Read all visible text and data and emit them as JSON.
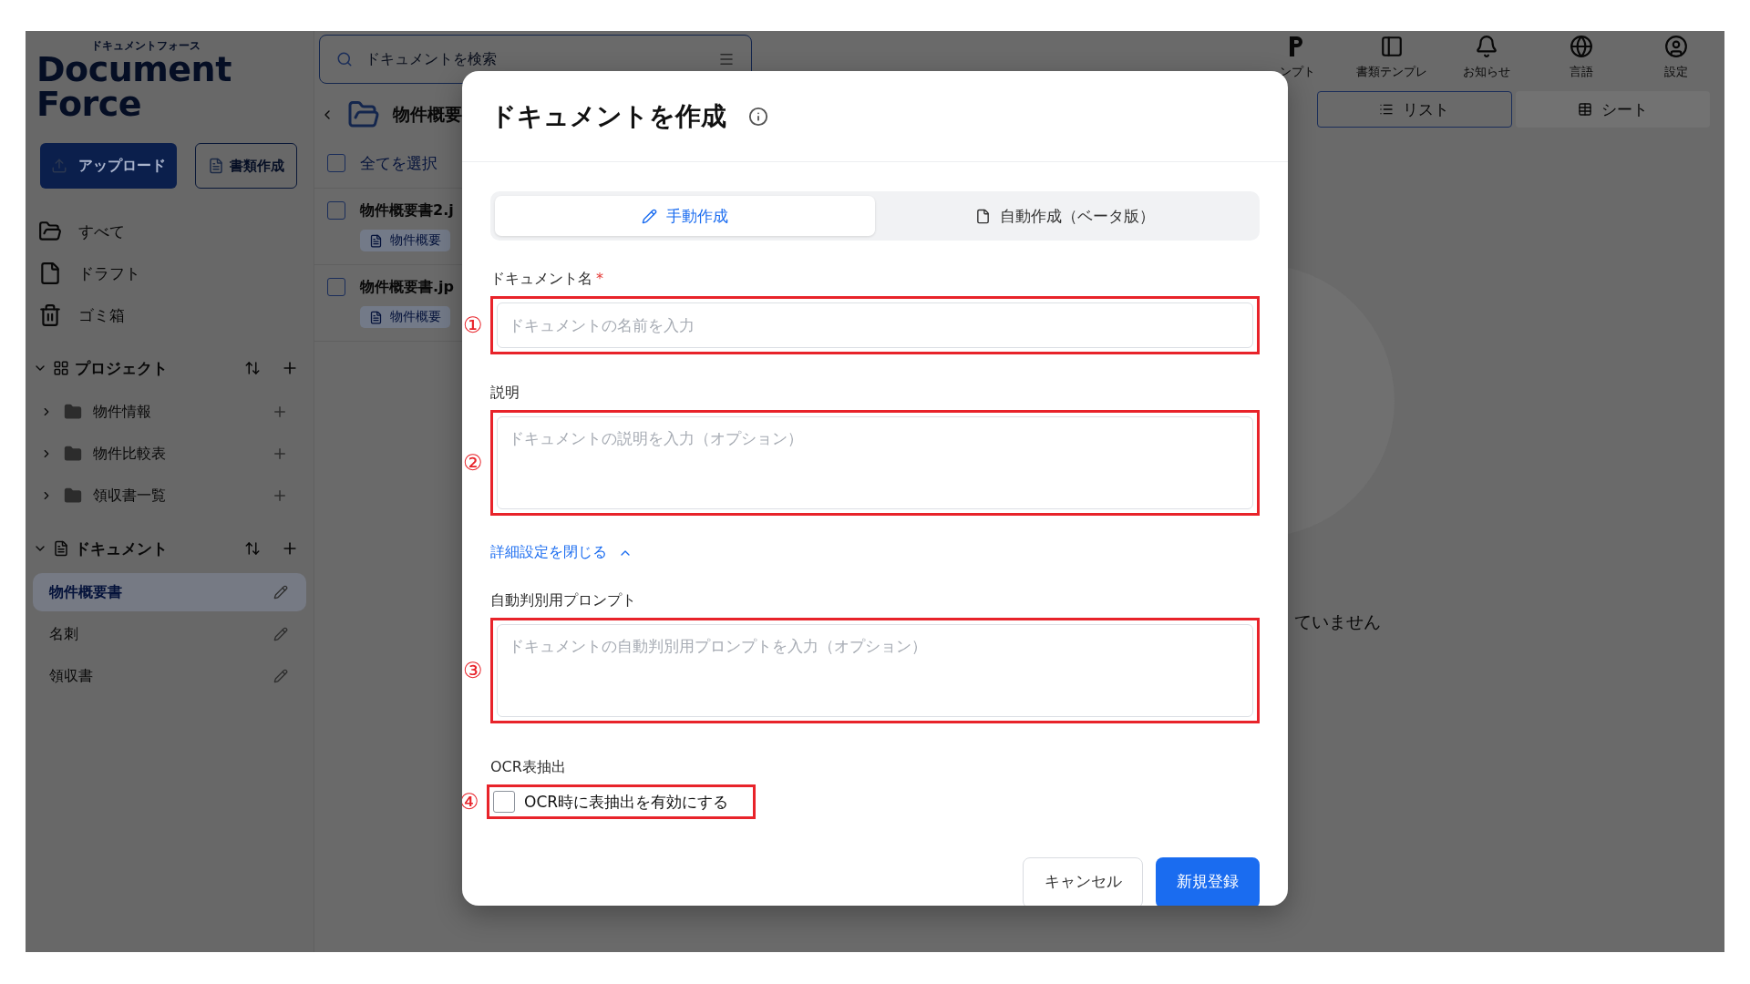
{
  "app": {
    "logo": {
      "kana": "ドキュメントフォース",
      "name": "Document Force"
    },
    "upload_button": "アップロード",
    "create_button": "書類作成",
    "search": {
      "placeholder": "ドキュメントを検索"
    },
    "nav": [
      "すべて",
      "ドラフト",
      "ゴミ箱"
    ],
    "projects": {
      "title": "プロジェクト",
      "expanded": true,
      "items": [
        {
          "label": "物件情報",
          "expanded": false
        },
        {
          "label": "物件比較表",
          "expanded": false
        },
        {
          "label": "領収書一覧",
          "expanded": false
        }
      ]
    },
    "documents": {
      "title": "ドキュメント",
      "expanded": true,
      "items": [
        {
          "label": "物件概要書",
          "selected": true
        },
        {
          "label": "名刺",
          "selected": false
        },
        {
          "label": "領収書",
          "selected": false
        }
      ]
    },
    "breadcrumb": "物件概要",
    "select_all": {
      "label": "全てを選択",
      "checked": false
    },
    "files": [
      {
        "name": "物件概要書2.j",
        "tag": "物件概要",
        "checked": false
      },
      {
        "name": "物件概要書.jp",
        "tag": "物件概要",
        "checked": false
      }
    ],
    "header_actions": [
      "ンプト",
      "書類テンプレ",
      "お知らせ",
      "言語",
      "設定"
    ],
    "view_tabs": [
      {
        "label": "リスト",
        "selected": true
      },
      {
        "label": "シート",
        "selected": false
      }
    ],
    "empty_message": "ていません"
  },
  "dialog": {
    "title": "ドキュメントを作成",
    "tabs": [
      {
        "label": "手動作成",
        "selected": true
      },
      {
        "label": "自動作成（ベータ版）",
        "selected": false
      }
    ],
    "fields": [
      {
        "kind": "input",
        "label": "ドキュメント名",
        "required_mark": "*",
        "placeholder": "ドキュメントの名前を入力",
        "marker": "①"
      },
      {
        "kind": "textarea",
        "label": "説明",
        "placeholder": "ドキュメントの説明を入力（オプション）",
        "marker": "②"
      }
    ],
    "advanced": {
      "toggle": "詳細設定を閉じる",
      "expanded": true,
      "fields": [
        {
          "kind": "textarea",
          "label": "自動判別用プロンプト",
          "placeholder": "ドキュメントの自動判別用プロンプトを入力（オプション）",
          "marker": "③"
        }
      ]
    },
    "ocr": {
      "title": "OCR表抽出",
      "label": "OCR時に表抽出を有効にする",
      "checked": false,
      "marker": "④"
    },
    "buttons": {
      "cancel": "キャンセル",
      "submit": "新規登録"
    }
  }
}
